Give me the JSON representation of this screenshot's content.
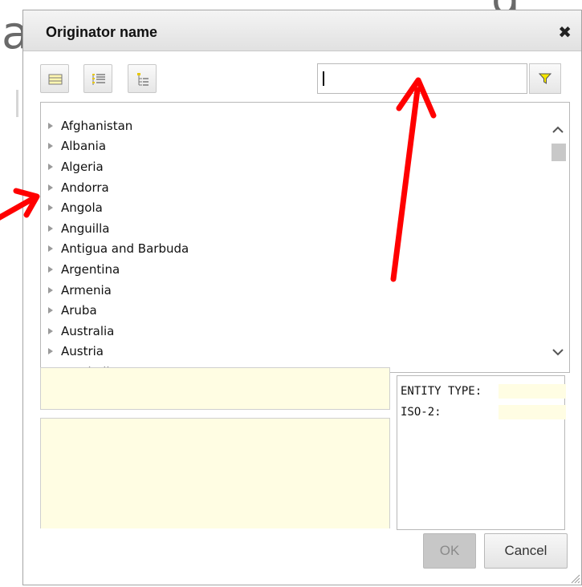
{
  "background": {
    "partial_text_left": "al",
    "partial_text_right": "g"
  },
  "dialog": {
    "title": "Originator name",
    "close_glyph": "✖"
  },
  "toolbar": {
    "buttons": [
      {
        "name": "collapse-all-icon"
      },
      {
        "name": "expand-list-icon"
      },
      {
        "name": "tree-view-icon"
      }
    ],
    "search": {
      "value": "",
      "placeholder": ""
    },
    "filter_icon": "filter-icon",
    "filter_color": "#f3e600"
  },
  "tree": {
    "items": [
      {
        "label": "Afghanistan"
      },
      {
        "label": "Albania"
      },
      {
        "label": "Algeria"
      },
      {
        "label": "Andorra"
      },
      {
        "label": "Angola"
      },
      {
        "label": "Anguilla"
      },
      {
        "label": "Antigua and Barbuda"
      },
      {
        "label": "Argentina"
      },
      {
        "label": "Armenia"
      },
      {
        "label": "Aruba"
      },
      {
        "label": "Australia"
      },
      {
        "label": "Austria"
      },
      {
        "label": "Azerbaijan"
      }
    ]
  },
  "details": {
    "entity_type_label": "ENTITY TYPE:",
    "entity_type_value": "",
    "iso2_label": "ISO-2:",
    "iso2_value": ""
  },
  "footer": {
    "ok_label": "OK",
    "cancel_label": "Cancel"
  },
  "colors": {
    "field_yellow": "#fffde3",
    "annotation_red": "#ff0000"
  }
}
